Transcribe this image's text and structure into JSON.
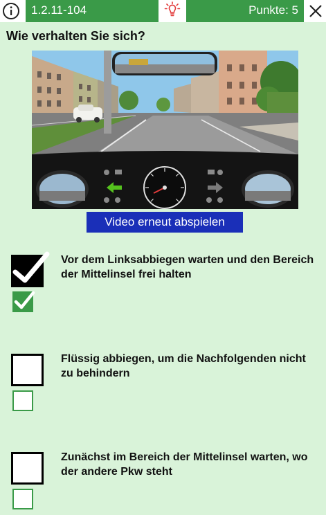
{
  "header": {
    "question_id": "1.2.11-104",
    "points": "Punkte: 5"
  },
  "question": "Wie verhalten Sie sich?",
  "video": {
    "replay_label": "Video erneut abspielen"
  },
  "answers": [
    {
      "lines": [
        "Vor dem Linksabbiegen warten und den Bereich",
        "der Mittelinsel frei halten"
      ],
      "user_checked": true,
      "solution_checked": true
    },
    {
      "lines": [
        "Flüssig abbiegen, um die Nachfolgenden nicht",
        "zu behindern"
      ],
      "user_checked": false,
      "solution_checked": false
    },
    {
      "lines": [
        "Zunächst im Bereich der Mittelinsel warten, wo",
        "der andere Pkw steht"
      ],
      "user_checked": false,
      "solution_checked": false
    }
  ],
  "colors": {
    "accent_green": "#3a9a48",
    "background": "#d9f3d9",
    "replay_button": "#1a2fb8",
    "bulb": "#e23b3b"
  },
  "icons": {
    "info": "info-icon",
    "hint": "lightbulb-icon",
    "close": "close-icon"
  }
}
